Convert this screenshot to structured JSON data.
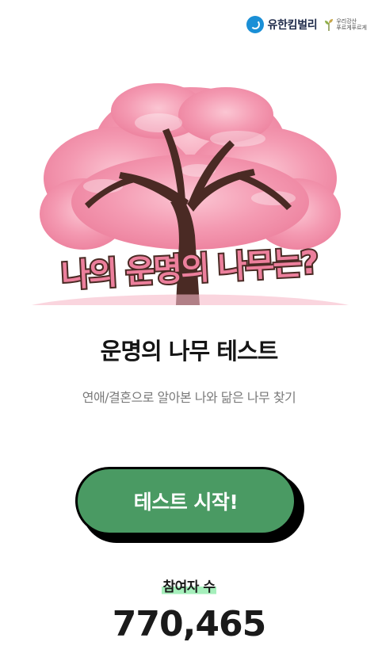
{
  "header": {
    "brand_name": "유한킴벌리",
    "brand_icon": "yuhan-kimberly-logo-icon",
    "campaign_line1": "우리강산",
    "campaign_line2": "푸르게푸르게",
    "campaign_icon": "tree-sprout-icon"
  },
  "hero": {
    "illustration": "cherry-blossom-tree-illustration",
    "overlay_title": "나의 운명의 나무는?"
  },
  "main": {
    "title": "운명의 나무 테스트",
    "subtitle": "연애/결혼으로 알아본 나와 닮은 나무 찾기",
    "start_button_label": "테스트 시작!"
  },
  "stats": {
    "label": "참여자 수",
    "count": "770,465"
  },
  "colors": {
    "button_fill": "#4a9a63",
    "label_highlight": "#a5efbb",
    "blossom_pink": "#f49ab2",
    "trunk_brown": "#4a2a24",
    "brand_blue": "#1a8fd6"
  }
}
